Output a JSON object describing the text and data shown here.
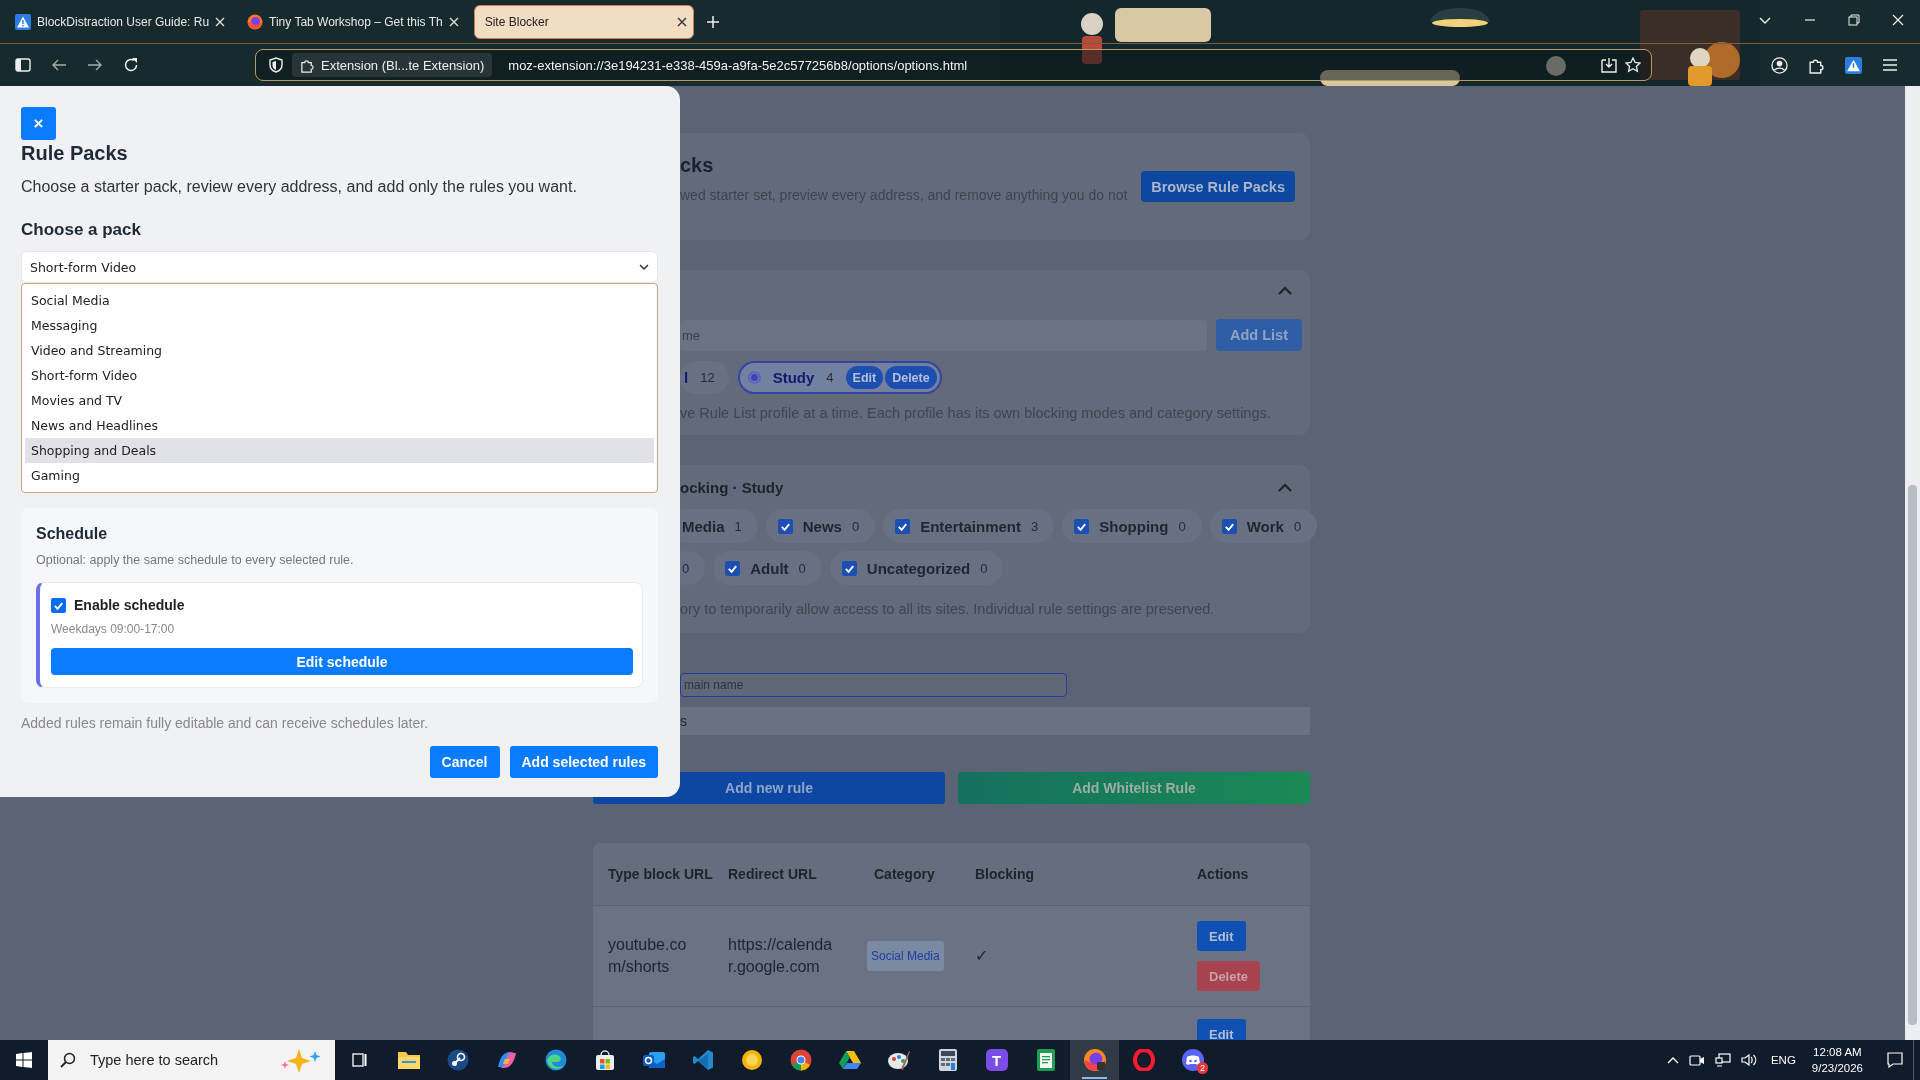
{
  "browser": {
    "tabs": [
      {
        "title": "BlockDistraction User Guide: Ru",
        "kind": "warning",
        "selected": false
      },
      {
        "title": "Tiny Tab Workshop – Get this Th",
        "kind": "firefox",
        "selected": false
      },
      {
        "title": "Site Blocker",
        "kind": "plain",
        "selected": true
      }
    ],
    "identity": "Extension (Bl...te Extension)",
    "url": "moz-extension://3e194231-e338-459a-a9fa-5e2c577256b8/options/options.html"
  },
  "page": {
    "packs_card": {
      "title": "cks",
      "description": "wed starter set, preview every address, and remove anything you do not",
      "button": "Browse Rule Packs"
    },
    "lists_card": {
      "name_placeholder": "me",
      "add_button": "Add List",
      "lists": [
        {
          "name": "l",
          "count": "12",
          "selected": false
        },
        {
          "name": "Study",
          "count": "4",
          "selected": true,
          "edit": "Edit",
          "delete": "Delete"
        }
      ],
      "note": "ve Rule List profile at a time. Each profile has its own blocking modes and category settings."
    },
    "categories_card": {
      "title": "ocking · Study",
      "rows": [
        {
          "chips": [
            {
              "name": "Media",
              "count": "1"
            },
            {
              "name": "News",
              "count": "0",
              "checked": true
            },
            {
              "name": "Entertainment",
              "count": "3",
              "checked": true
            },
            {
              "name": "Shopping",
              "count": "0",
              "checked": true
            },
            {
              "name": "Work",
              "count": "0",
              "checked": true
            }
          ]
        },
        {
          "chips": [
            {
              "count": "0"
            },
            {
              "name": "Adult",
              "count": "0",
              "checked": true
            },
            {
              "name": "Uncategorized",
              "count": "0",
              "checked": true
            }
          ]
        }
      ],
      "note": "ory to temporarily allow access to all its sites. Individual rule settings are preserved."
    },
    "domain_field": {
      "placeholder": "main name"
    },
    "category_filter": {
      "value": "s"
    },
    "actions": [
      {
        "label": "Add new rule",
        "kind": "primary"
      },
      {
        "label": "Add Whitelist Rule",
        "kind": "whitelist"
      }
    ],
    "table": {
      "columns": [
        "Type block URL",
        "Redirect URL",
        "Category",
        "Blocking",
        "Actions"
      ],
      "rows": [
        {
          "url": "youtube.com/shorts",
          "redirect": "https://calendar.google.com",
          "category": "Social Media",
          "blocking": "✓",
          "actions": [
            {
              "label": "Edit",
              "kind": "edit"
            },
            {
              "label": "Delete",
              "kind": "delete"
            }
          ]
        },
        {
          "actions": [
            {
              "label": "Edit",
              "kind": "edit"
            }
          ]
        }
      ]
    }
  },
  "dialog": {
    "close": "×",
    "title": "Rule Packs",
    "description": "Choose a starter pack, review every address, and add only the rules you want.",
    "pack_label": "Choose a pack",
    "pack_value": "Short-form Video",
    "pack_options": [
      {
        "label": "Social Media",
        "selected": false
      },
      {
        "label": "Messaging",
        "selected": false
      },
      {
        "label": "Video and Streaming",
        "selected": false
      },
      {
        "label": "Short-form Video",
        "selected": false
      },
      {
        "label": "Movies and TV",
        "selected": false
      },
      {
        "label": "News and Headlines",
        "selected": false
      },
      {
        "label": "Shopping and Deals",
        "selected": true
      },
      {
        "label": "Gaming",
        "selected": false
      }
    ],
    "schedule": {
      "title": "Schedule",
      "hint": "Optional: apply the same schedule to every selected rule.",
      "enabled": true,
      "enable_label": "Enable schedule",
      "summary": "Weekdays 09:00-17:00",
      "edit_button": "Edit schedule"
    },
    "footnote": "Added rules remain fully editable and can receive schedules later.",
    "buttons": [
      {
        "label": "Cancel"
      },
      {
        "label": "Add selected rules"
      }
    ]
  },
  "taskbar": {
    "search_placeholder": "Type here to search",
    "apps": [
      {
        "kind": "taskview",
        "selected": false
      },
      {
        "kind": "folder",
        "selected": false
      },
      {
        "kind": "disc",
        "selected": false
      },
      {
        "kind": "swirl",
        "selected": false
      },
      {
        "kind": "wave",
        "selected": false
      },
      {
        "kind": "bag",
        "selected": false
      },
      {
        "kind": "mail",
        "selected": false
      },
      {
        "kind": "code",
        "selected": false
      },
      {
        "kind": "sun",
        "selected": false
      },
      {
        "kind": "wheel",
        "selected": false
      },
      {
        "kind": "triangle",
        "selected": false
      },
      {
        "kind": "palette",
        "selected": false
      },
      {
        "kind": "calculator",
        "selected": false
      },
      {
        "kind": "tile",
        "label": "T",
        "selected": false
      },
      {
        "kind": "note",
        "selected": false
      },
      {
        "kind": "globe",
        "selected": true
      },
      {
        "kind": "ring",
        "selected": false
      },
      {
        "kind": "gamepad",
        "badge": "2",
        "selected": false
      }
    ],
    "language": "ENG",
    "time": "12:08 AM",
    "date": "9/23/2026"
  }
}
